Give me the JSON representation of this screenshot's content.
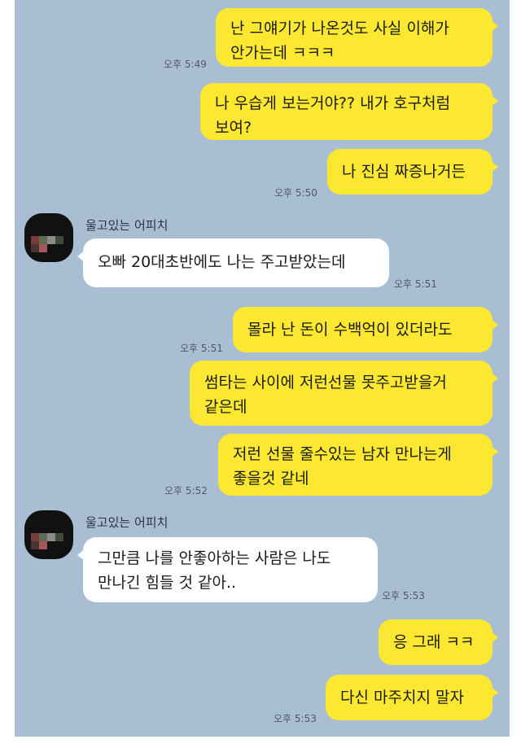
{
  "messages": [
    {
      "id": "m1",
      "text": "난 그얘기가 나온것도 사실 이해가\n안가는데 ㅋㅋㅋ"
    },
    {
      "id": "m2",
      "text": "나 우습게 보는거야?? 내가 호구처럼\n보여?"
    },
    {
      "id": "m3",
      "text": "나 진심 짜증나거든"
    },
    {
      "id": "m4",
      "text": "오빠 20대초반에도 나는 주고받았는데"
    },
    {
      "id": "m5",
      "text": "몰라 난 돈이 수백억이 있더라도"
    },
    {
      "id": "m6",
      "text": "썸타는 사이에 저런선물 못주고받을거\n같은데"
    },
    {
      "id": "m7",
      "text": "저런 선물 줄수있는 남자 만나는게\n좋을것 같네"
    },
    {
      "id": "m8",
      "text": "그만큼 나를 안좋아하는 사람은 나도\n만나긴 힘들 것 같아.."
    },
    {
      "id": "m9",
      "text": "응 그래 ㅋㅋ"
    },
    {
      "id": "m10",
      "text": "다신 마주치지 말자"
    }
  ],
  "times": {
    "t1": "오후 5:49",
    "t2": "오후 5:50",
    "t3": "오후 5:51",
    "t4": "오후 5:51",
    "t5": "오후 5:52",
    "t6": "오후 5:53",
    "t7": "오후 5:53"
  },
  "sender_name": "울고있는 어피치",
  "colors": {
    "background": "#a9bdd3",
    "my_bubble": "#fce830",
    "their_bubble": "#ffffff"
  }
}
